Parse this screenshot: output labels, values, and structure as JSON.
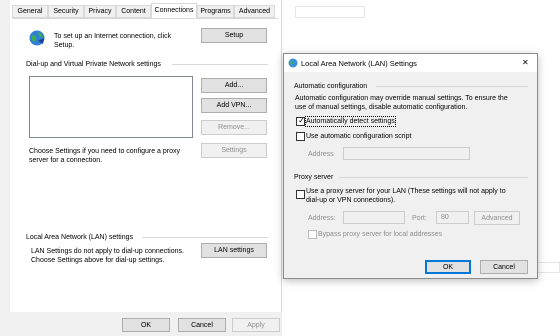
{
  "left_window": {
    "tabs": [
      "General",
      "Security",
      "Privacy",
      "Content",
      "Connections",
      "Programs",
      "Advanced"
    ],
    "setup_text": "To set up an Internet connection, click Setup.",
    "setup_line1": "To set up an Internet connection, click",
    "setup_line2": "Setup.",
    "setup_button": "Setup",
    "dialup_section": "Dial-up and Virtual Private Network settings",
    "add_button": "Add...",
    "add_vpn_button": "Add VPN...",
    "remove_button": "Remove...",
    "settings_text_line1": "Choose Settings if you need to configure a proxy",
    "settings_text_line2": "server for a connection.",
    "settings_button": "Settings",
    "lan_section": "Local Area Network (LAN) settings",
    "lan_text_line1": "LAN Settings do not apply to dial-up connections.",
    "lan_text_line2": "Choose Settings above for dial-up settings.",
    "lan_settings_button": "LAN settings",
    "ok_button": "OK",
    "cancel_button": "Cancel",
    "apply_button": "Apply"
  },
  "lan_dialog": {
    "title": "Local Area Network (LAN) Settings",
    "close_glyph": "✕",
    "auto_group": "Automatic configuration",
    "auto_desc_line1": "Automatic configuration may override manual settings.  To ensure the",
    "auto_desc_line2": "use of manual settings, disable automatic configuration.",
    "auto_detect_label": "Automatically detect settings",
    "auto_detect_checked": true,
    "use_script_label": "Use automatic configuration script",
    "use_script_checked": false,
    "address_label": "Address",
    "proxy_group": "Proxy server",
    "proxy_label_line1": "Use a proxy server for your LAN (These settings will not apply to",
    "proxy_label_line2": "dial-up or VPN connections).",
    "proxy_checked": false,
    "proxy_address_label": "Address:",
    "port_label": "Port:",
    "port_value": "80",
    "advanced_button": "Advanced",
    "bypass_label": "Bypass proxy server for local addresses",
    "ok_button": "OK",
    "cancel_button": "Cancel"
  }
}
